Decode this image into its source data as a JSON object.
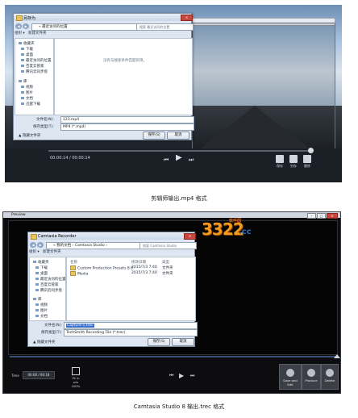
{
  "shot1": {
    "dialog": {
      "title": "另存为",
      "address": "« 最近访问的位置",
      "search_placeholder": "搜索 最近访问的位置",
      "toolbar": [
        "组织 ▾",
        "新建文件夹"
      ],
      "sidebar": [
        "收藏夹",
        "下载",
        "桌面",
        "最近访问的位置",
        "百度云管家",
        "腾讯云同步盘",
        "库",
        "视频",
        "图片",
        "文档",
        "迅雷下载"
      ],
      "empty_message": "没有与搜索条件匹配的项。",
      "filename_label": "文件名(N):",
      "filename_value": "123.mp4",
      "filetype_label": "保存类型(T):",
      "filetype_value": "MP4 (*.mp4)",
      "hide_folders": "隐藏文件夹",
      "save": "保存(S)",
      "cancel": "取消"
    },
    "time": "00:00:14 / 00:00:14",
    "tools": [
      "保存",
      "另存",
      "删除"
    ]
  },
  "caption1": "剪辑师输出.mp4 格式",
  "shot2": {
    "window_title": "Preview",
    "dialog": {
      "title": "Camtasia Recorder",
      "address": "« 我的文档 › Camtasia Studio ›",
      "search_placeholder": "搜索 Camtasia Studio",
      "toolbar": [
        "组织 ▾",
        "新建文件夹"
      ],
      "sidebar": [
        "收藏夹",
        "下载",
        "桌面",
        "最近访问的位置",
        "百度云管家",
        "腾讯云同步盘",
        "库",
        "视频",
        "图片",
        "文档"
      ],
      "col_name": "名称",
      "col_date": "修改日期",
      "col_type": "类型",
      "files": [
        {
          "name": "Custom Production Presets 8.0",
          "date": "2015/7/3 7:40",
          "type": "文件夹"
        },
        {
          "name": "Media",
          "date": "2015/7/3 7:40",
          "type": "文件夹"
        }
      ],
      "filename_label": "文件名(N):",
      "filename_value": "Capture-1.trec",
      "filetype_label": "保存类型(T):",
      "filetype_value": "TechSmith Recording File (*.trec)",
      "hide_folders": "隐藏文件夹",
      "save": "保存(S)",
      "cancel": "取消"
    },
    "time_label": "Time",
    "time": "00:00 / 00:18",
    "fit_label": "Fit in win 100%",
    "buttons": [
      "Save and Edit",
      "Produce",
      "Delete"
    ]
  },
  "logo": {
    "main": "3322",
    "cc": ".cc",
    "sub": "软件园"
  },
  "caption2": "Camtasia Studio 8 输出.trec 格式"
}
